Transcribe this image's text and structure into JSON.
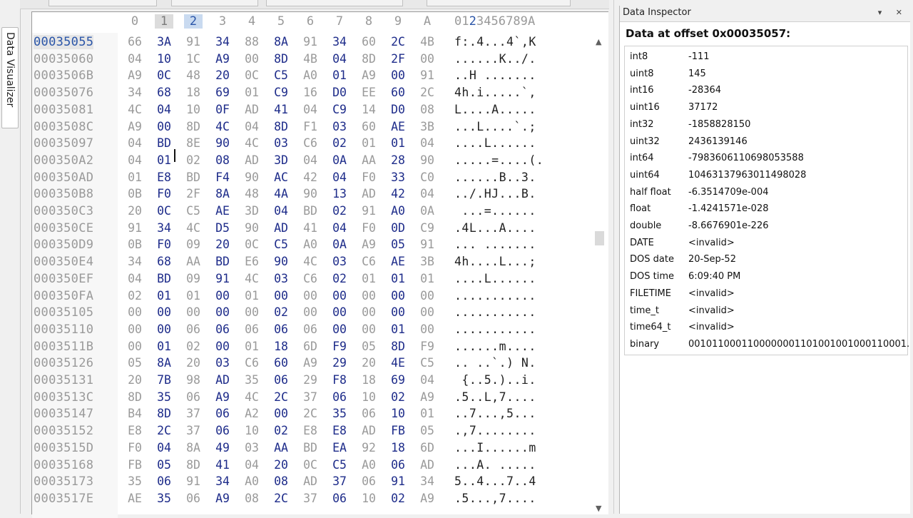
{
  "side_tab": {
    "label": "Data Visualizer"
  },
  "hex": {
    "column_headers": [
      "0",
      "1",
      "2",
      "3",
      "4",
      "5",
      "6",
      "7",
      "8",
      "9",
      "A"
    ],
    "ascii_header": "0123456789A",
    "rows": [
      {
        "offset": "00035055",
        "bytes": [
          "66",
          "3A",
          "91",
          "34",
          "88",
          "8A",
          "91",
          "34",
          "60",
          "2C",
          "4B"
        ],
        "ascii": "f:.4...4`,K"
      },
      {
        "offset": "00035060",
        "bytes": [
          "04",
          "10",
          "1C",
          "A9",
          "00",
          "8D",
          "4B",
          "04",
          "8D",
          "2F",
          "00"
        ],
        "ascii": "......K../."
      },
      {
        "offset": "0003506B",
        "bytes": [
          "A9",
          "0C",
          "48",
          "20",
          "0C",
          "C5",
          "A0",
          "01",
          "A9",
          "00",
          "91"
        ],
        "ascii": "..H ......."
      },
      {
        "offset": "00035076",
        "bytes": [
          "34",
          "68",
          "18",
          "69",
          "01",
          "C9",
          "16",
          "D0",
          "EE",
          "60",
          "2C"
        ],
        "ascii": "4h.i.....`,"
      },
      {
        "offset": "00035081",
        "bytes": [
          "4C",
          "04",
          "10",
          "0F",
          "AD",
          "41",
          "04",
          "C9",
          "14",
          "D0",
          "08"
        ],
        "ascii": "L....A....."
      },
      {
        "offset": "0003508C",
        "bytes": [
          "A9",
          "00",
          "8D",
          "4C",
          "04",
          "8D",
          "F1",
          "03",
          "60",
          "AE",
          "3B"
        ],
        "ascii": "...L....`.;"
      },
      {
        "offset": "00035097",
        "bytes": [
          "04",
          "BD",
          "8E",
          "90",
          "4C",
          "03",
          "C6",
          "02",
          "01",
          "01",
          "04"
        ],
        "ascii": "....L......"
      },
      {
        "offset": "000350A2",
        "bytes": [
          "04",
          "01",
          "02",
          "08",
          "AD",
          "3D",
          "04",
          "0A",
          "AA",
          "28",
          "90"
        ],
        "ascii": ".....=....(."
      },
      {
        "offset": "000350AD",
        "bytes": [
          "01",
          "E8",
          "BD",
          "F4",
          "90",
          "AC",
          "42",
          "04",
          "F0",
          "33",
          "C0"
        ],
        "ascii": "......B..3."
      },
      {
        "offset": "000350B8",
        "bytes": [
          "0B",
          "F0",
          "2F",
          "8A",
          "48",
          "4A",
          "90",
          "13",
          "AD",
          "42",
          "04"
        ],
        "ascii": "../.HJ...B."
      },
      {
        "offset": "000350C3",
        "bytes": [
          "20",
          "0C",
          "C5",
          "AE",
          "3D",
          "04",
          "BD",
          "02",
          "91",
          "A0",
          "0A"
        ],
        "ascii": " ...=......"
      },
      {
        "offset": "000350CE",
        "bytes": [
          "91",
          "34",
          "4C",
          "D5",
          "90",
          "AD",
          "41",
          "04",
          "F0",
          "0D",
          "C9"
        ],
        "ascii": ".4L...A...."
      },
      {
        "offset": "000350D9",
        "bytes": [
          "0B",
          "F0",
          "09",
          "20",
          "0C",
          "C5",
          "A0",
          "0A",
          "A9",
          "05",
          "91"
        ],
        "ascii": "... ......."
      },
      {
        "offset": "000350E4",
        "bytes": [
          "34",
          "68",
          "AA",
          "BD",
          "E6",
          "90",
          "4C",
          "03",
          "C6",
          "AE",
          "3B"
        ],
        "ascii": "4h....L...;"
      },
      {
        "offset": "000350EF",
        "bytes": [
          "04",
          "BD",
          "09",
          "91",
          "4C",
          "03",
          "C6",
          "02",
          "01",
          "01",
          "01"
        ],
        "ascii": "....L......"
      },
      {
        "offset": "000350FA",
        "bytes": [
          "02",
          "01",
          "01",
          "00",
          "01",
          "00",
          "00",
          "00",
          "00",
          "00",
          "00"
        ],
        "ascii": "..........."
      },
      {
        "offset": "00035105",
        "bytes": [
          "00",
          "00",
          "00",
          "00",
          "00",
          "02",
          "00",
          "00",
          "00",
          "00",
          "00"
        ],
        "ascii": "..........."
      },
      {
        "offset": "00035110",
        "bytes": [
          "00",
          "00",
          "06",
          "06",
          "06",
          "06",
          "06",
          "00",
          "00",
          "01",
          "00"
        ],
        "ascii": "..........."
      },
      {
        "offset": "0003511B",
        "bytes": [
          "00",
          "01",
          "02",
          "00",
          "01",
          "18",
          "6D",
          "F9",
          "05",
          "8D",
          "F9"
        ],
        "ascii": "......m...."
      },
      {
        "offset": "00035126",
        "bytes": [
          "05",
          "8A",
          "20",
          "03",
          "C6",
          "60",
          "A9",
          "29",
          "20",
          "4E",
          "C5"
        ],
        "ascii": ".. ..`.) N."
      },
      {
        "offset": "00035131",
        "bytes": [
          "20",
          "7B",
          "98",
          "AD",
          "35",
          "06",
          "29",
          "F8",
          "18",
          "69",
          "04"
        ],
        "ascii": " {..5.)..i."
      },
      {
        "offset": "0003513C",
        "bytes": [
          "8D",
          "35",
          "06",
          "A9",
          "4C",
          "2C",
          "37",
          "06",
          "10",
          "02",
          "A9"
        ],
        "ascii": ".5..L,7...."
      },
      {
        "offset": "00035147",
        "bytes": [
          "B4",
          "8D",
          "37",
          "06",
          "A2",
          "00",
          "2C",
          "35",
          "06",
          "10",
          "01"
        ],
        "ascii": "..7...,5..."
      },
      {
        "offset": "00035152",
        "bytes": [
          "E8",
          "2C",
          "37",
          "06",
          "10",
          "02",
          "E8",
          "E8",
          "AD",
          "FB",
          "05"
        ],
        "ascii": ".,7........"
      },
      {
        "offset": "0003515D",
        "bytes": [
          "F0",
          "04",
          "8A",
          "49",
          "03",
          "AA",
          "BD",
          "EA",
          "92",
          "18",
          "6D"
        ],
        "ascii": "...I......m"
      },
      {
        "offset": "00035168",
        "bytes": [
          "FB",
          "05",
          "8D",
          "41",
          "04",
          "20",
          "0C",
          "C5",
          "A0",
          "06",
          "AD"
        ],
        "ascii": "...A. ....."
      },
      {
        "offset": "00035173",
        "bytes": [
          "35",
          "06",
          "91",
          "34",
          "A0",
          "08",
          "AD",
          "37",
          "06",
          "91",
          "34"
        ],
        "ascii": "5..4...7..4"
      },
      {
        "offset": "0003517E",
        "bytes": [
          "AE",
          "35",
          "06",
          "A9",
          "08",
          "2C",
          "37",
          "06",
          "10",
          "02",
          "A9"
        ],
        "ascii": ".5...,7...."
      }
    ]
  },
  "inspector": {
    "title": "Data Inspector",
    "title_buttons": "▾ ✕",
    "heading": "Data at offset 0x00035057:",
    "rows": [
      {
        "label": "int8",
        "value": "-111"
      },
      {
        "label": "uint8",
        "value": "145"
      },
      {
        "label": "int16",
        "value": "-28364"
      },
      {
        "label": "uint16",
        "value": "37172"
      },
      {
        "label": "int32",
        "value": "-1858828150"
      },
      {
        "label": "uint32",
        "value": "2436139146"
      },
      {
        "label": "int64",
        "value": "-7983606110698053588"
      },
      {
        "label": "uint64",
        "value": "10463137963011498028"
      },
      {
        "label": "half float",
        "value": "-6.3514709e-004"
      },
      {
        "label": "float",
        "value": "-1.4241571e-028"
      },
      {
        "label": "double",
        "value": "-8.6676901e-226"
      },
      {
        "label": "DATE",
        "value": "<invalid>"
      },
      {
        "label": "DOS date",
        "value": "20-Sep-52"
      },
      {
        "label": "DOS time",
        "value": "6:09:40 PM"
      },
      {
        "label": "FILETIME",
        "value": "<invalid>"
      },
      {
        "label": "time_t",
        "value": "<invalid>"
      },
      {
        "label": "time64_t",
        "value": "<invalid>"
      },
      {
        "label": "binary",
        "value": "0010110001100000001101001001000110001..."
      }
    ]
  }
}
